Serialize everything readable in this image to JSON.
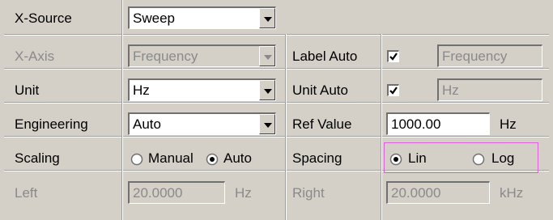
{
  "rows": {
    "x_source": {
      "label": "X-Source",
      "value": "Sweep"
    },
    "x_axis": {
      "label": "X-Axis",
      "value": "Frequency",
      "label_auto": "Label Auto",
      "label_auto_checked": true,
      "label_value": "Frequency"
    },
    "unit": {
      "label": "Unit",
      "value": "Hz",
      "unit_auto": "Unit Auto",
      "unit_auto_checked": true,
      "unit_value": "Hz"
    },
    "engineering": {
      "label": "Engineering",
      "value": "Auto",
      "ref_label": "Ref Value",
      "ref_value": "1000.00",
      "ref_unit": "Hz"
    },
    "scaling": {
      "label": "Scaling",
      "manual": "Manual",
      "auto": "Auto",
      "selected": "Auto",
      "spacing_label": "Spacing",
      "lin": "Lin",
      "log": "Log",
      "spacing_selected": "Lin"
    },
    "limits": {
      "left_label": "Left",
      "left_value": "20.0000",
      "left_unit": "Hz",
      "right_label": "Right",
      "right_value": "20.0000",
      "right_unit": "kHz"
    }
  },
  "colors": {
    "panel": "#d4d0c8",
    "disabled_text": "#8a8a8a",
    "highlight": "#e060e0"
  }
}
